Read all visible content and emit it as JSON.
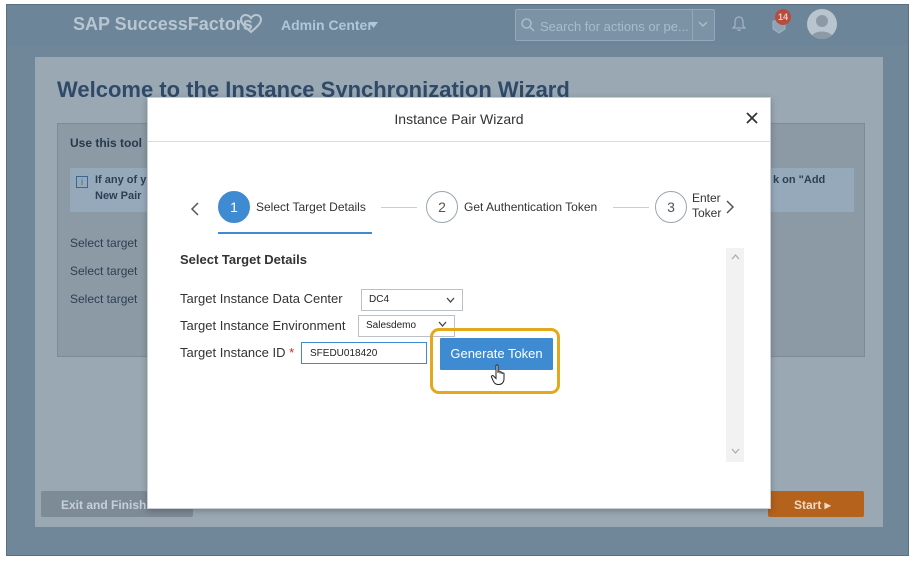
{
  "shell": {
    "brand": "SAP SuccessFactors",
    "admin_center": "Admin Center",
    "search_placeholder": "Search for actions or pe...",
    "notification_count": "14"
  },
  "background": {
    "title": "Welcome to the Instance Synchronization Wizard",
    "card_heading": "Use this tool",
    "info_line1": "If any of y",
    "info_line2": "New Pair",
    "info_right": "k on \"Add",
    "rows": [
      "Select target",
      "Select target",
      "Select target"
    ],
    "exit_button": "Exit and Finish",
    "start_button": "Start ▸"
  },
  "dialog": {
    "title": "Instance Pair Wizard",
    "steps": [
      {
        "number": "1",
        "label": "Select Target Details",
        "active": true
      },
      {
        "number": "2",
        "label": "Get Authentication Token",
        "active": false
      },
      {
        "number": "3",
        "label_line1": "Enter",
        "label_line2": "Toker",
        "active": false
      }
    ],
    "section_title": "Select Target Details",
    "fields": {
      "data_center": {
        "label": "Target Instance Data Center",
        "value": "DC4"
      },
      "environment": {
        "label": "Target Instance Environment",
        "value": "Salesdemo"
      },
      "instance_id": {
        "label": "Target Instance ID",
        "required_mark": "*",
        "value": "SFEDU018420"
      }
    },
    "generate_button": "Generate Token"
  },
  "colors": {
    "accent": "#3f8bd1",
    "highlight": "#e3a81c",
    "start_button": "#b4621c"
  }
}
